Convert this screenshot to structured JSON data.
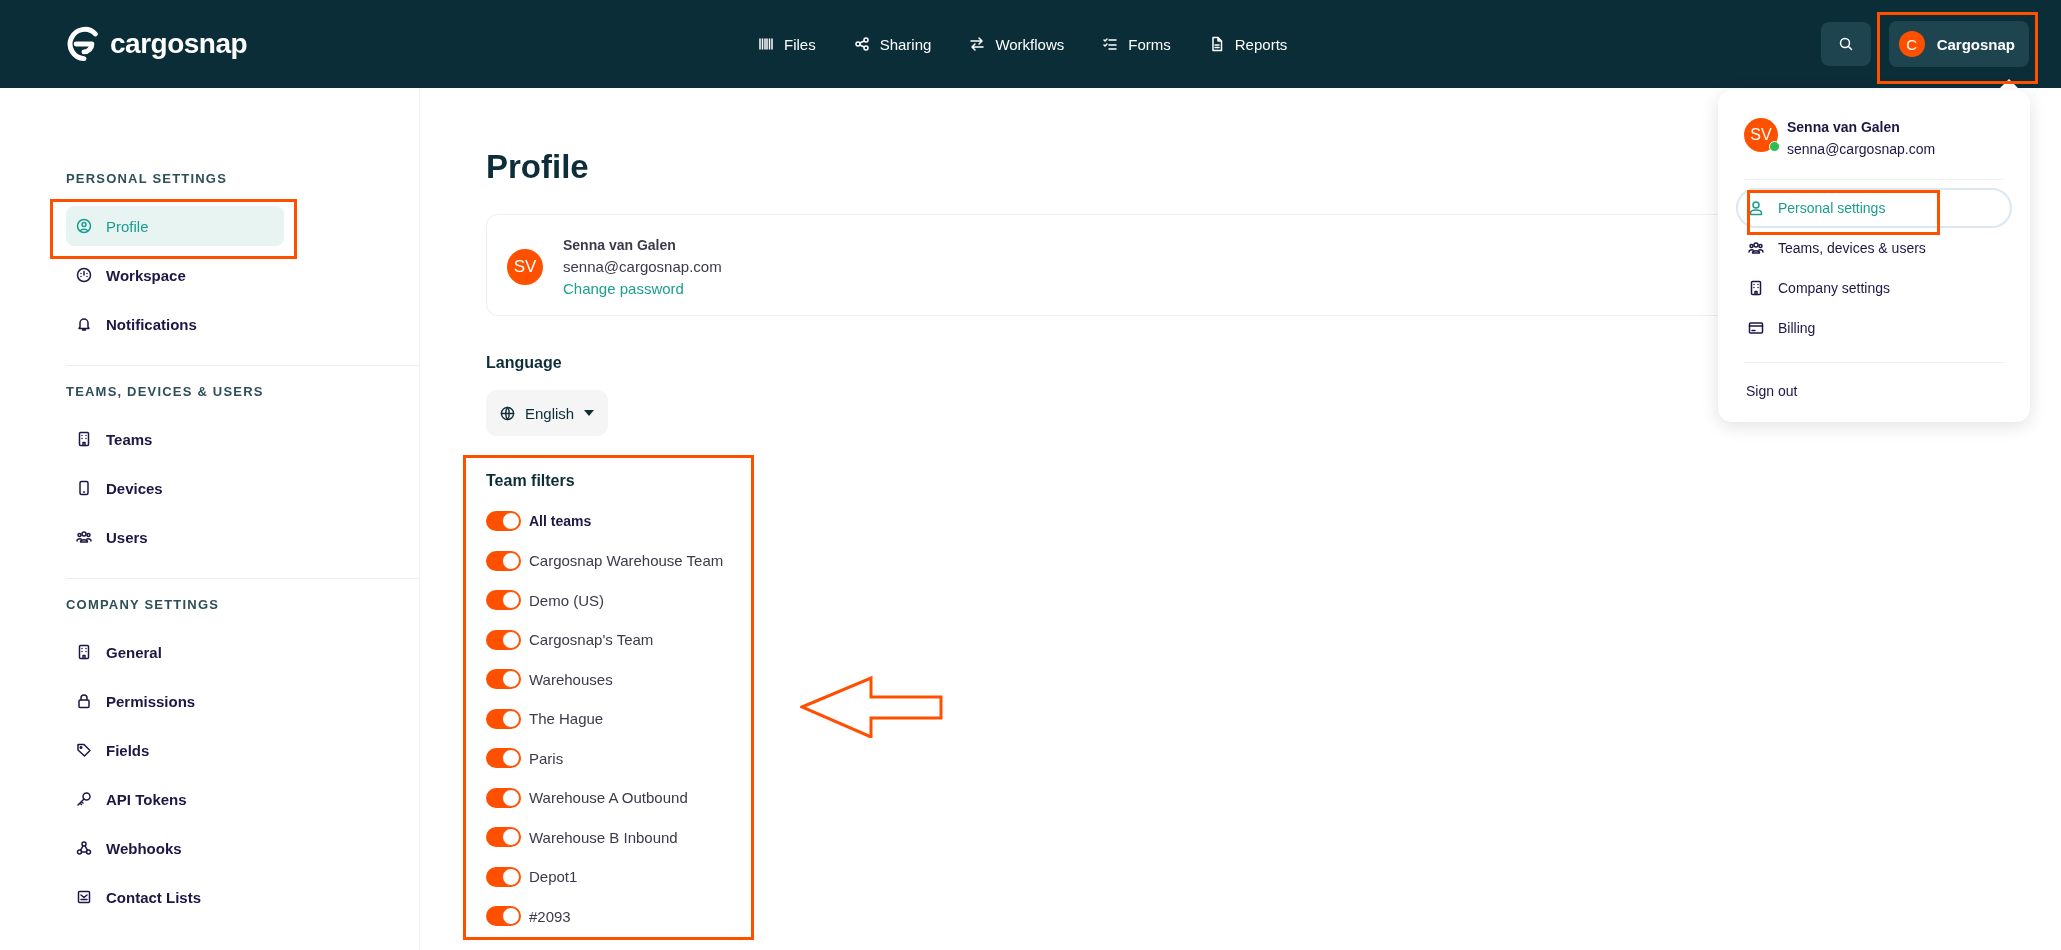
{
  "header": {
    "logo": "cargosnap",
    "nav": [
      {
        "label": "Files"
      },
      {
        "label": "Sharing"
      },
      {
        "label": "Workflows"
      },
      {
        "label": "Forms"
      },
      {
        "label": "Reports"
      }
    ],
    "account": {
      "initial": "C",
      "name": "Cargosnap"
    }
  },
  "sidebar": {
    "sections": [
      {
        "title": "PERSONAL SETTINGS",
        "items": [
          {
            "label": "Profile",
            "selected": true
          },
          {
            "label": "Workspace",
            "selected": false
          },
          {
            "label": "Notifications",
            "selected": false
          }
        ]
      },
      {
        "title": "TEAMS, DEVICES & USERS",
        "items": [
          {
            "label": "Teams",
            "selected": false
          },
          {
            "label": "Devices",
            "selected": false
          },
          {
            "label": "Users",
            "selected": false
          }
        ]
      },
      {
        "title": "COMPANY SETTINGS",
        "items": [
          {
            "label": "General",
            "selected": false
          },
          {
            "label": "Permissions",
            "selected": false
          },
          {
            "label": "Fields",
            "selected": false
          },
          {
            "label": "API Tokens",
            "selected": false
          },
          {
            "label": "Webhooks",
            "selected": false
          },
          {
            "label": "Contact Lists",
            "selected": false
          }
        ]
      }
    ]
  },
  "profile": {
    "title": "Profile",
    "card": {
      "initials": "SV",
      "name": "Senna van Galen",
      "email": "senna@cargosnap.com",
      "link": "Change password"
    },
    "language": {
      "label": "Language",
      "value": "English"
    },
    "team_filters": {
      "title": "Team filters",
      "items": [
        {
          "label": "All teams",
          "kind": "all",
          "on": true
        },
        {
          "label": "Cargosnap Warehouse Team",
          "kind": "team",
          "on": true
        },
        {
          "label": "Demo (US)",
          "kind": "team",
          "on": true
        },
        {
          "label": "Cargosnap's Team",
          "kind": "team",
          "on": true
        },
        {
          "label": "Warehouses",
          "kind": "team",
          "on": true
        },
        {
          "label": "The Hague",
          "kind": "team",
          "on": true
        },
        {
          "label": "Paris",
          "kind": "team",
          "on": true
        },
        {
          "label": "Warehouse A Outbound",
          "kind": "team",
          "on": true
        },
        {
          "label": "Warehouse B Inbound",
          "kind": "team",
          "on": true
        },
        {
          "label": "Depot1",
          "kind": "team",
          "on": true
        },
        {
          "label": "#2093",
          "kind": "team",
          "on": true
        }
      ]
    }
  },
  "account_menu": {
    "initials": "SV",
    "online": true,
    "name": "Senna van Galen",
    "email": "senna@cargosnap.com",
    "items": [
      {
        "label": "Personal settings",
        "selected": true
      },
      {
        "label": "Teams, devices & users",
        "selected": false
      },
      {
        "label": "Company settings",
        "selected": false
      },
      {
        "label": "Billing",
        "selected": false
      }
    ],
    "sign_out": "Sign out"
  }
}
